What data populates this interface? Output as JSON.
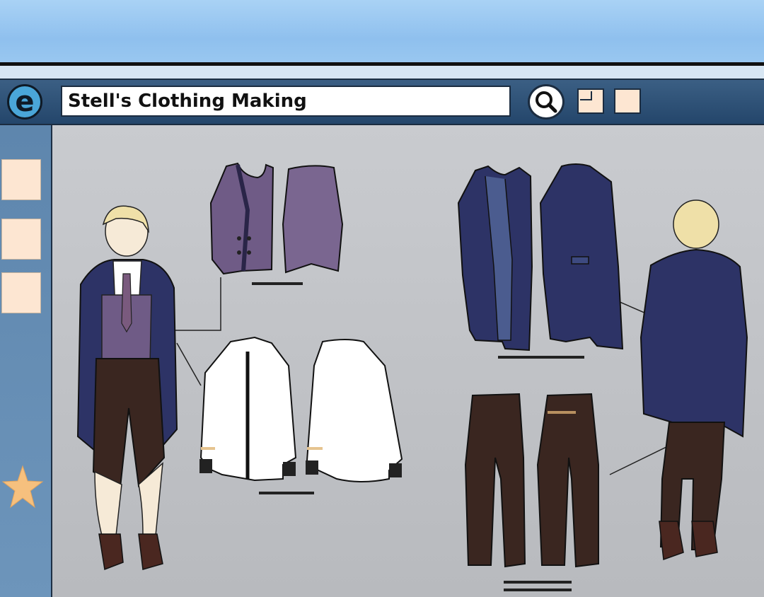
{
  "address_bar": {
    "title": "Stell's Clothing Making"
  },
  "browser": {
    "logo_letter": "e"
  },
  "icons": {
    "browser_logo": "internet-explorer-icon",
    "search": "search-icon",
    "restore": "window-restore-icon",
    "maximize": "window-maximize-icon",
    "favorite": "star-icon"
  },
  "sidebar": {
    "items": [
      "blank-tab",
      "blank-tab",
      "blank-tab",
      "favorites-star"
    ]
  },
  "colors": {
    "toolbar": "#2c4f75",
    "sidebar": "#6389af",
    "button_fill": "#fde6d2",
    "star": "#f6c07e",
    "coat_navy": "#2d3366",
    "vest_purple": "#6f5b86",
    "shirt_white": "#ffffff",
    "pants_brown": "#3a2620"
  }
}
